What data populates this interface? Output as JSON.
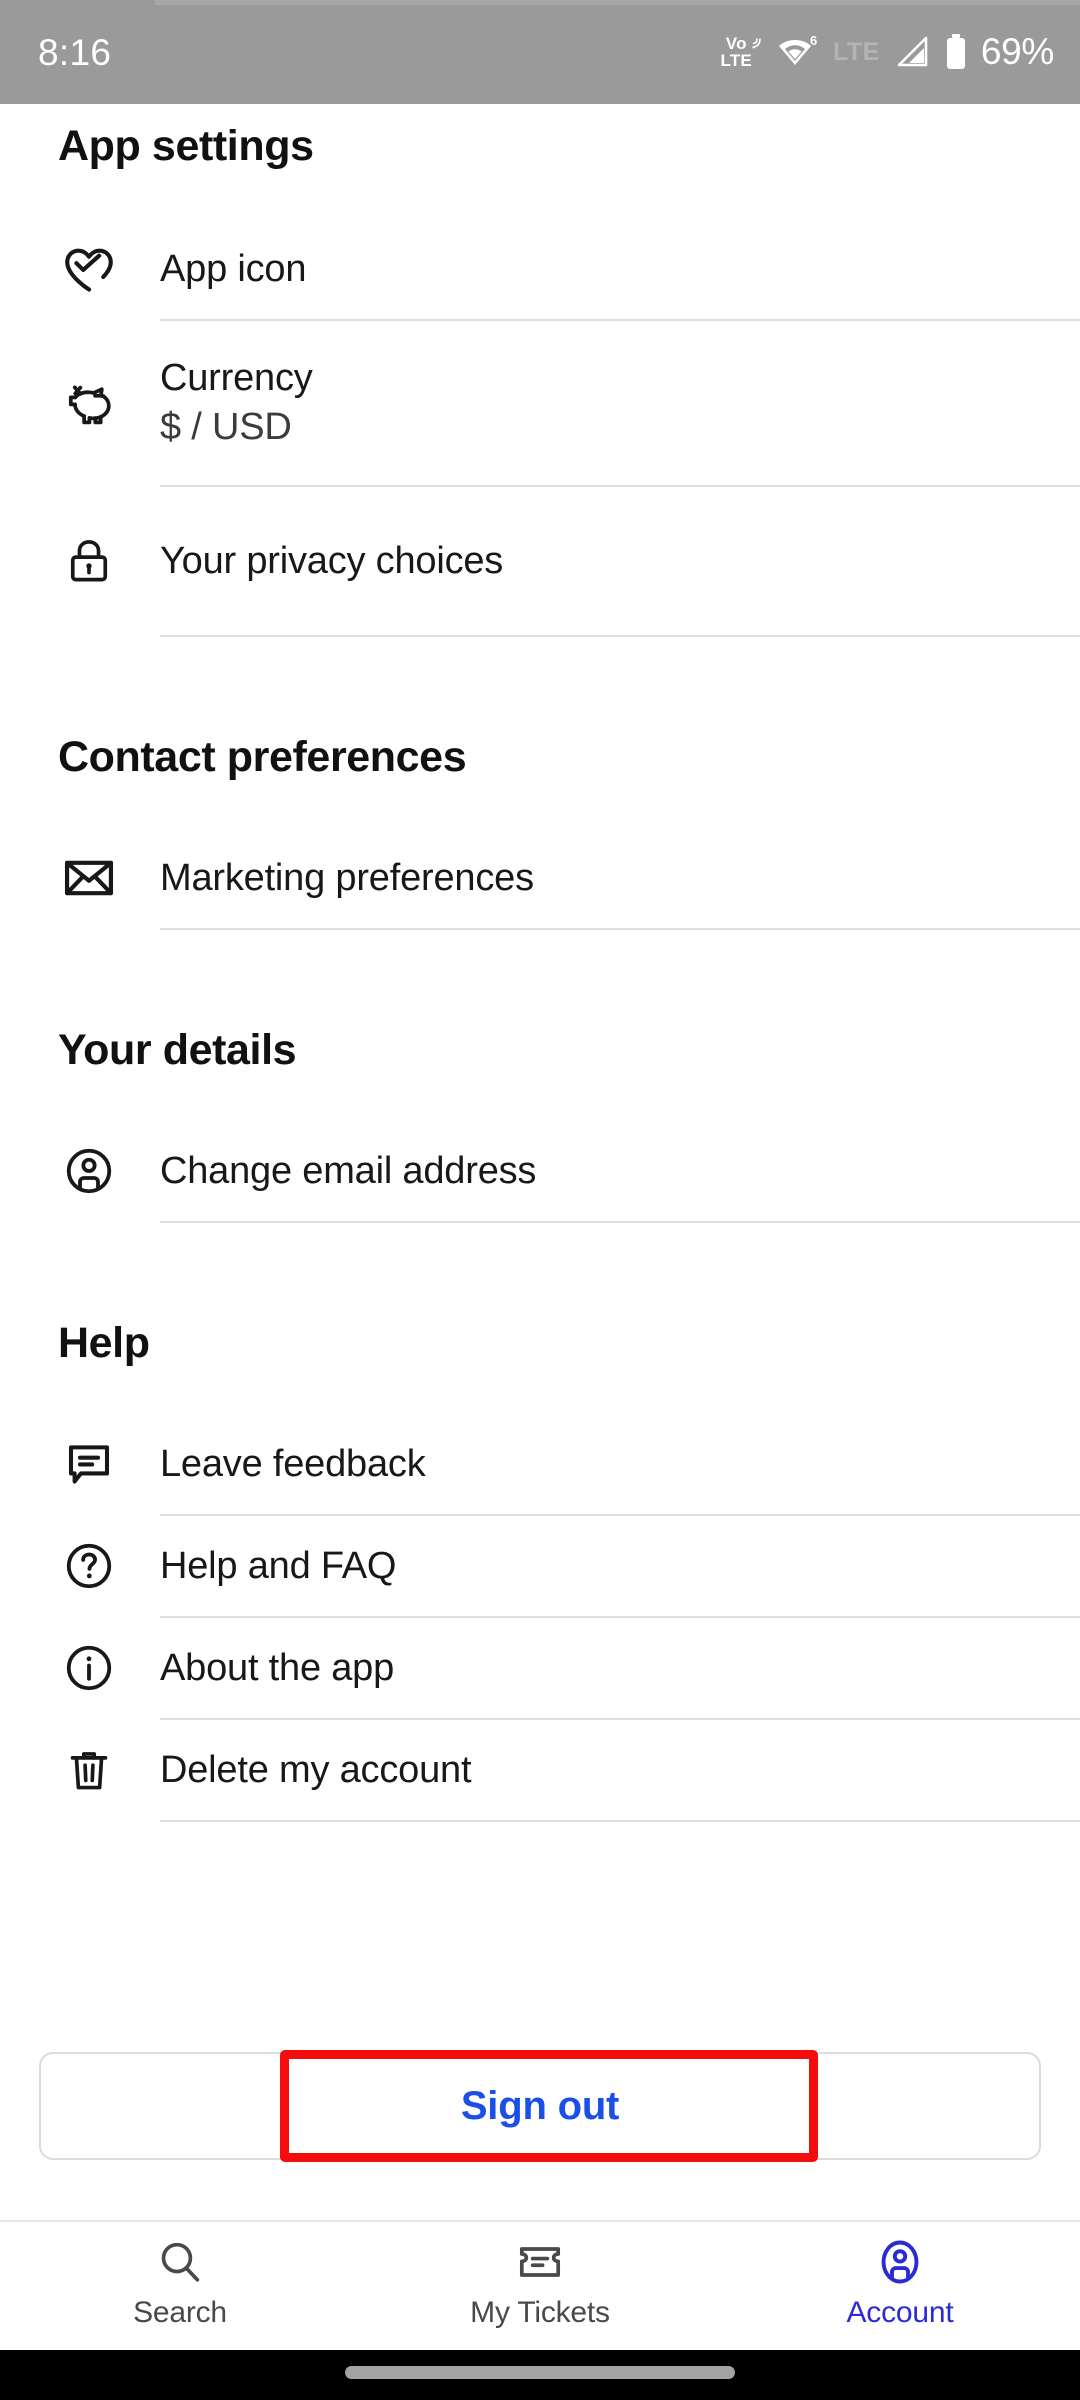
{
  "statusbar": {
    "time": "8:16",
    "volte_vo": "Vo",
    "volte_lte": "LTE",
    "lte_label": "LTE",
    "battery_percent": "69%",
    "icons": [
      "volte-icon",
      "wifi-icon",
      "lte-icon",
      "signal-icon",
      "battery-icon"
    ]
  },
  "sections": [
    {
      "title": "App settings",
      "items": [
        {
          "label": "App icon",
          "sub": "",
          "icon": "heart-check-icon"
        },
        {
          "label": "Currency",
          "sub": "$ / USD",
          "icon": "piggy-bank-icon"
        },
        {
          "label": "Your privacy choices",
          "sub": "",
          "icon": "lock-icon"
        }
      ]
    },
    {
      "title": "Contact preferences",
      "items": [
        {
          "label": "Marketing preferences",
          "sub": "",
          "icon": "envelope-icon"
        }
      ]
    },
    {
      "title": "Your details",
      "items": [
        {
          "label": "Change email address",
          "sub": "",
          "icon": "person-circle-icon"
        }
      ]
    },
    {
      "title": "Help",
      "items": [
        {
          "label": "Leave feedback",
          "sub": "",
          "icon": "speech-bubble-icon"
        },
        {
          "label": "Help and FAQ",
          "sub": "",
          "icon": "question-circle-icon"
        },
        {
          "label": "About the app",
          "sub": "",
          "icon": "info-circle-icon"
        },
        {
          "label": "Delete my account",
          "sub": "",
          "icon": "trash-icon"
        }
      ]
    }
  ],
  "signout": {
    "label": "Sign out",
    "text_color": "#1b4fe8",
    "highlight_color": "#f40d0d"
  },
  "bottomnav": {
    "items": [
      {
        "label": "Search",
        "icon": "search-icon",
        "active": false
      },
      {
        "label": "My Tickets",
        "icon": "ticket-icon",
        "active": false
      },
      {
        "label": "Account",
        "icon": "account-icon",
        "active": true
      }
    ],
    "active_color": "#2b2bd4",
    "inactive_color": "#47494c"
  }
}
